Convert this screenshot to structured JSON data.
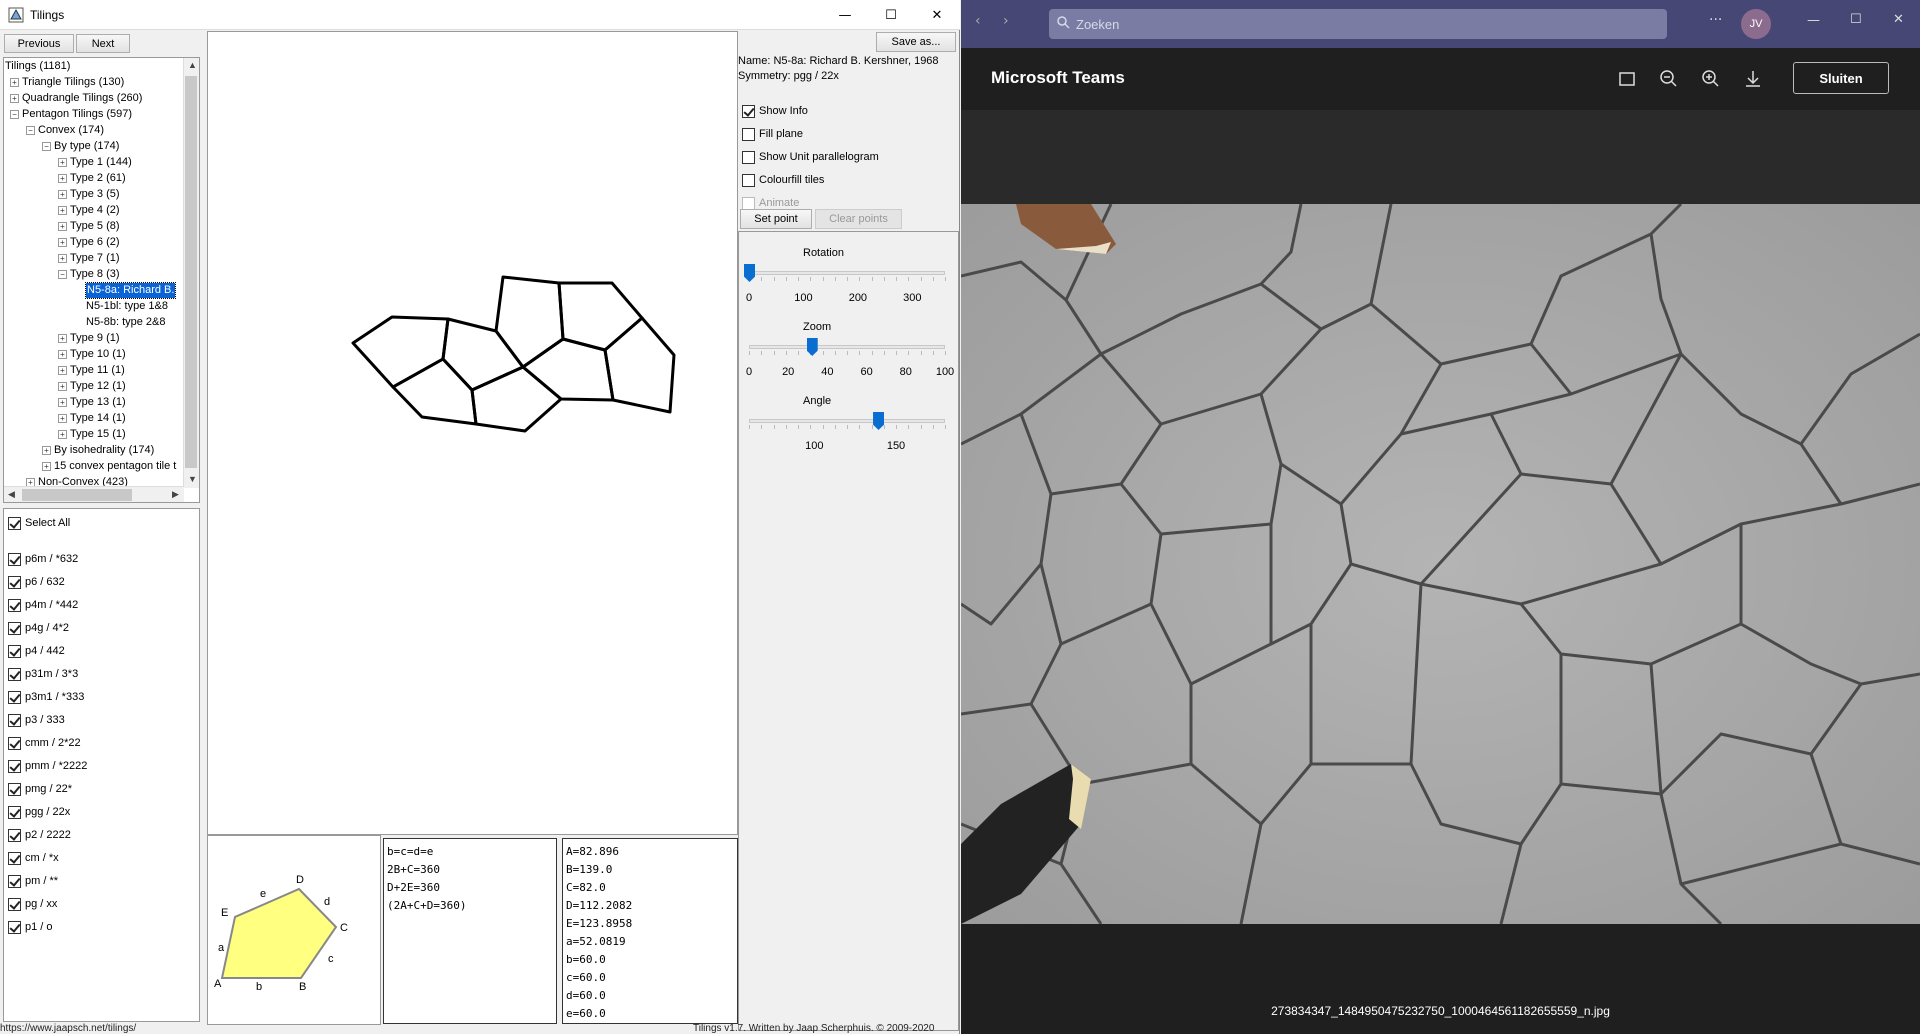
{
  "app": {
    "title": "Tilings",
    "nav": {
      "previous": "Previous",
      "next": "Next"
    },
    "save_as": "Save as...",
    "window_controls": {
      "minimize": "—",
      "maximize": "☐",
      "close": "✕"
    }
  },
  "tree": {
    "rows": [
      {
        "label": "Tilings (1181)",
        "indent": 0,
        "exp": ""
      },
      {
        "label": "Triangle Tilings (130)",
        "indent": 1,
        "exp": "+"
      },
      {
        "label": "Quadrangle Tilings (260)",
        "indent": 1,
        "exp": "+"
      },
      {
        "label": "Pentagon Tilings (597)",
        "indent": 1,
        "exp": "−"
      },
      {
        "label": "Convex (174)",
        "indent": 2,
        "exp": "−"
      },
      {
        "label": "By type (174)",
        "indent": 3,
        "exp": "−"
      },
      {
        "label": "Type 1 (144)",
        "indent": 4,
        "exp": "+"
      },
      {
        "label": "Type 2 (61)",
        "indent": 4,
        "exp": "+"
      },
      {
        "label": "Type 3 (5)",
        "indent": 4,
        "exp": "+"
      },
      {
        "label": "Type 4 (2)",
        "indent": 4,
        "exp": "+"
      },
      {
        "label": "Type 5 (8)",
        "indent": 4,
        "exp": "+"
      },
      {
        "label": "Type 6 (2)",
        "indent": 4,
        "exp": "+"
      },
      {
        "label": "Type 7 (1)",
        "indent": 4,
        "exp": "+"
      },
      {
        "label": "Type 8 (3)",
        "indent": 4,
        "exp": "−"
      },
      {
        "label": "N5-8a: Richard B.",
        "indent": 5,
        "exp": "",
        "selected": true
      },
      {
        "label": "N5-1bl: type 1&8",
        "indent": 5,
        "exp": ""
      },
      {
        "label": "N5-8b: type 2&8",
        "indent": 5,
        "exp": ""
      },
      {
        "label": "Type 9 (1)",
        "indent": 4,
        "exp": "+"
      },
      {
        "label": "Type 10 (1)",
        "indent": 4,
        "exp": "+"
      },
      {
        "label": "Type 11 (1)",
        "indent": 4,
        "exp": "+"
      },
      {
        "label": "Type 12 (1)",
        "indent": 4,
        "exp": "+"
      },
      {
        "label": "Type 13 (1)",
        "indent": 4,
        "exp": "+"
      },
      {
        "label": "Type 14 (1)",
        "indent": 4,
        "exp": "+"
      },
      {
        "label": "Type 15 (1)",
        "indent": 4,
        "exp": "+"
      },
      {
        "label": "By isohedrality (174)",
        "indent": 3,
        "exp": "+"
      },
      {
        "label": "15 convex pentagon tile t",
        "indent": 3,
        "exp": "+"
      },
      {
        "label": "Non-Convex (423)",
        "indent": 2,
        "exp": "+"
      }
    ]
  },
  "symmetry": {
    "select_all": "Select All",
    "items": [
      "p6m / *632",
      "p6 / 632",
      "p4m / *442",
      "p4g / 4*2",
      "p4 / 442",
      "p31m / 3*3",
      "p3m1 / *333",
      "p3 / 333",
      "cmm / 2*22",
      "pmm / *2222",
      "pmg / 22*",
      "pgg / 22x",
      "p2 / 2222",
      "cm / *x",
      "pm / **",
      "pg / xx",
      "p1 / o"
    ]
  },
  "info": {
    "name": "Name: N5-8a: Richard B. Kershner, 1968",
    "symmetry": "Symmetry: pgg / 22x"
  },
  "options": [
    {
      "label": "Show Info",
      "checked": true,
      "disabled": false
    },
    {
      "label": "Fill plane",
      "checked": false,
      "disabled": false
    },
    {
      "label": "Show Unit parallelogram",
      "checked": false,
      "disabled": false
    },
    {
      "label": "Colourfill tiles",
      "checked": false,
      "disabled": false
    },
    {
      "label": "Animate",
      "checked": false,
      "disabled": true
    }
  ],
  "points": {
    "set": "Set point",
    "clear": "Clear points"
  },
  "sliders": {
    "rotation": {
      "label": "Rotation",
      "ticks": [
        "0",
        "100",
        "200",
        "300"
      ],
      "value": 0,
      "min": 0,
      "max": 360
    },
    "zoom": {
      "label": "Zoom",
      "ticks": [
        "0",
        "20",
        "40",
        "60",
        "80",
        "100"
      ],
      "value": 32,
      "min": 0,
      "max": 100
    },
    "angle": {
      "label": "Angle",
      "ticks": [
        "100",
        "150"
      ],
      "value": 139,
      "min": 60,
      "max": 180
    }
  },
  "tile_labels": {
    "vertices": [
      "A",
      "B",
      "C",
      "D",
      "E"
    ],
    "edges": [
      "a",
      "b",
      "c",
      "d",
      "e"
    ]
  },
  "equations": [
    "b=c=d=e",
    "2B+C=360",
    "D+2E=360",
    "(2A+C+D=360)"
  ],
  "angles": [
    "A=82.896",
    "B=139.0",
    "C=82.0",
    "D=112.2082",
    "E=123.8958",
    "a=52.0819",
    "b=60.0",
    "c=60.0",
    "d=60.0",
    "e=60.0"
  ],
  "status": {
    "url": "https://www.jaapsch.net/tilings/",
    "credit": "Tilings v1.7. Written by Jaap Scherphuis. © 2009-2020"
  },
  "teams": {
    "search_placeholder": "Zoeken",
    "avatar": "JV",
    "title": "Microsoft Teams",
    "close": "Sluiten",
    "filename": "273834347_1484950475232750_1000464561182655559_n.jpg"
  },
  "colors": {
    "selection": "#0a64d6",
    "teams_bar": "#464775",
    "tile_fill": "#ffff80",
    "slider_thumb": "#0a6ed1"
  }
}
